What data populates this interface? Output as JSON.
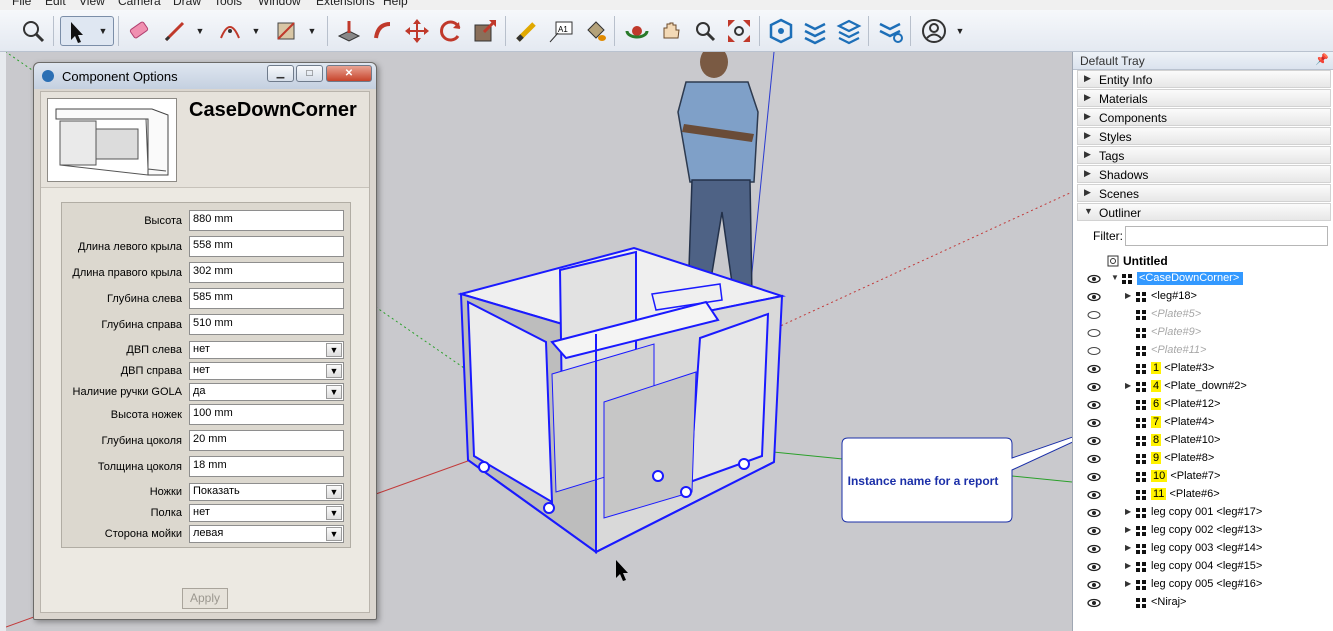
{
  "menu": [
    "File",
    "Edit",
    "View",
    "Camera",
    "Draw",
    "Tools",
    "Window",
    "Extensions",
    "Help"
  ],
  "toolbar": {
    "tools": [
      "zoom-icon",
      "select-icon",
      "eraser-icon",
      "pencil-icon",
      "arc-icon",
      "rectangle-icon",
      "push-pull-icon",
      "follow-me-icon",
      "move-icon",
      "rotate-icon",
      "scale-icon",
      "tape-measure-icon",
      "text-icon",
      "paint-bucket-icon",
      "orbit-icon",
      "pan-icon",
      "zoom-window-icon",
      "zoom-extents-icon",
      "warehouse-icon",
      "extension-warehouse-icon",
      "layout-icon",
      "extension-manager-icon",
      "account-icon"
    ]
  },
  "dialog": {
    "title": "Component Options",
    "component_name": "CaseDownCorner",
    "apply_label": "Apply",
    "fields": [
      {
        "label": "Высота",
        "value": "880 mm",
        "kind": "text"
      },
      {
        "label": "Длина левого крыла",
        "value": "558 mm",
        "kind": "text"
      },
      {
        "label": "Длина правого крыла",
        "value": "302 mm",
        "kind": "text"
      },
      {
        "label": "Глубина слева",
        "value": "585 mm",
        "kind": "text"
      },
      {
        "label": "Глубина справа",
        "value": "510 mm",
        "kind": "text"
      },
      {
        "label": "ДВП слева",
        "value": "нет",
        "kind": "select"
      },
      {
        "label": "ДВП справа",
        "value": "нет",
        "kind": "select"
      },
      {
        "label": "Наличие ручки GOLA",
        "value": "да",
        "kind": "select"
      },
      {
        "label": "Высота ножек",
        "value": "100 mm",
        "kind": "text"
      },
      {
        "label": "Глубина цоколя",
        "value": "20 mm",
        "kind": "text"
      },
      {
        "label": "Толщина цоколя",
        "value": "18 mm",
        "kind": "text"
      },
      {
        "label": "Ножки",
        "value": "Показать",
        "kind": "select"
      },
      {
        "label": "Полка",
        "value": "нет",
        "kind": "select"
      },
      {
        "label": "Сторона мойки",
        "value": "левая",
        "kind": "select"
      }
    ]
  },
  "callout": {
    "text": "Instance name for a report"
  },
  "tray": {
    "title": "Default Tray",
    "panels": [
      "Entity Info",
      "Materials",
      "Components",
      "Styles",
      "Tags",
      "Shadows",
      "Scenes",
      "Outliner"
    ],
    "filter_label": "Filter:",
    "model_name": "Untitled",
    "outliner": [
      {
        "prefix": "",
        "name": "<CaseDownCorner>",
        "state": "selected",
        "expand": "▼",
        "visible": true
      },
      {
        "prefix": "",
        "name": "<leg#18>",
        "state": "normal",
        "expand": "▶",
        "visible": true
      },
      {
        "prefix": "",
        "name": "<Plate#5>",
        "state": "hidden",
        "expand": "",
        "visible": false
      },
      {
        "prefix": "",
        "name": "<Plate#9>",
        "state": "hidden",
        "expand": "",
        "visible": false
      },
      {
        "prefix": "",
        "name": "<Plate#11>",
        "state": "hidden",
        "expand": "",
        "visible": false
      },
      {
        "prefix": "1",
        "name": "<Plate#3>",
        "state": "normal",
        "expand": "",
        "visible": true
      },
      {
        "prefix": "4",
        "name": "<Plate_down#2>",
        "state": "normal",
        "expand": "▶",
        "visible": true
      },
      {
        "prefix": "6",
        "name": "<Plate#12>",
        "state": "normal",
        "expand": "",
        "visible": true
      },
      {
        "prefix": "7",
        "name": "<Plate#4>",
        "state": "normal",
        "expand": "",
        "visible": true
      },
      {
        "prefix": "8",
        "name": "<Plate#10>",
        "state": "normal",
        "expand": "",
        "visible": true
      },
      {
        "prefix": "9",
        "name": "<Plate#8>",
        "state": "normal",
        "expand": "",
        "visible": true
      },
      {
        "prefix": "10",
        "name": "<Plate#7>",
        "state": "normal",
        "expand": "",
        "visible": true
      },
      {
        "prefix": "11",
        "name": "<Plate#6>",
        "state": "normal",
        "expand": "",
        "visible": true
      },
      {
        "prefix": "",
        "name": "leg copy 001 <leg#17>",
        "state": "normal",
        "expand": "▶",
        "visible": true
      },
      {
        "prefix": "",
        "name": "leg copy 002 <leg#13>",
        "state": "normal",
        "expand": "▶",
        "visible": true
      },
      {
        "prefix": "",
        "name": "leg copy 003 <leg#14>",
        "state": "normal",
        "expand": "▶",
        "visible": true
      },
      {
        "prefix": "",
        "name": "leg copy 004 <leg#15>",
        "state": "normal",
        "expand": "▶",
        "visible": true
      },
      {
        "prefix": "",
        "name": "leg copy 005 <leg#16>",
        "state": "normal",
        "expand": "▶",
        "visible": true
      },
      {
        "prefix": "",
        "name": "<Niraj>",
        "state": "normal",
        "expand": "",
        "visible": true
      }
    ]
  },
  "colors": {
    "selection_blue": "#1a1aff",
    "viewport_bg": "#c9c9cd",
    "highlight_yellow": "#fff200",
    "outliner_selected": "#3399ff"
  }
}
